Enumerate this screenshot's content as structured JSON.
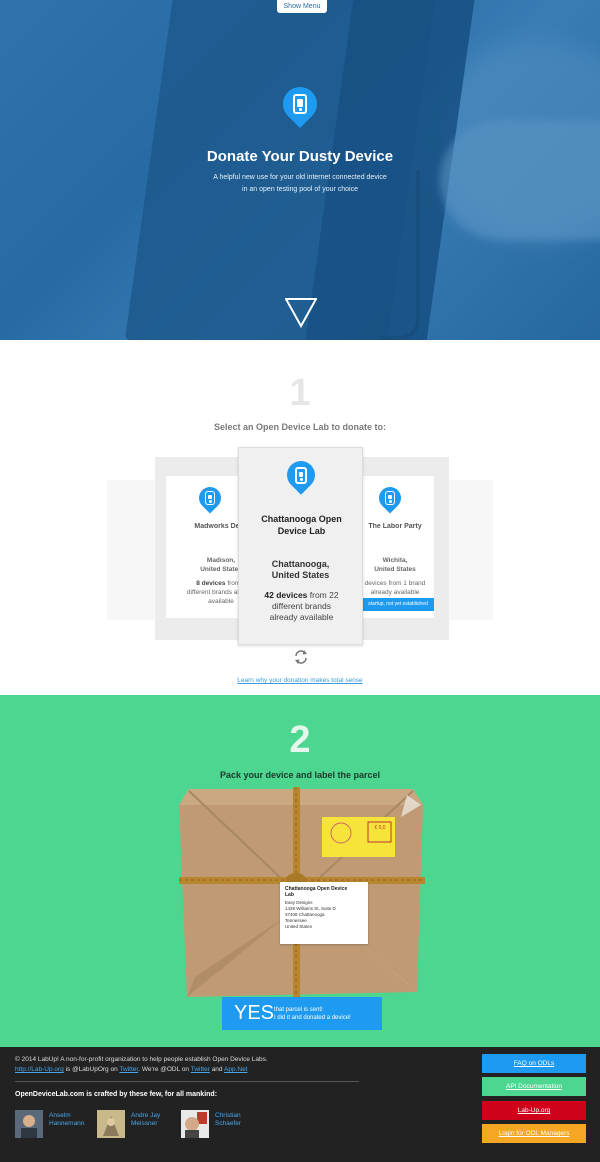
{
  "nav": {
    "show_menu": "Show Menu"
  },
  "hero": {
    "title": "Donate Your Dusty Device",
    "subtitle": "A helpful new use for your old internet connected device in an open testing pool of your choice"
  },
  "step1": {
    "number": "1",
    "label": "Select an Open Device Lab to donate to:",
    "labs": [
      {
        "name": "Madworks Device Lab",
        "city_line1": "Madison,",
        "city_line2": "United States",
        "devices_count": "8 devices",
        "devices_rest_1": " from 5",
        "devices_rest_2": "different brands already",
        "devices_rest_3": "available"
      },
      {
        "name_line1": "Chattanooga Open",
        "name_line2": "Device Lab",
        "city_line1": "Chattanooga,",
        "city_line2": "United States",
        "devices_count": "42 devices",
        "devices_rest_1": " from 22",
        "devices_rest_2": "different brands",
        "devices_rest_3": "already available"
      },
      {
        "name": "The Labor Party",
        "city_line1": "Wichita,",
        "city_line2": "United States",
        "devices_rest_1": "devices from 1 brand",
        "devices_rest_2": "already available",
        "badge": "startup, not yet established"
      }
    ],
    "learn_link": "Learn why your donation makes total sense"
  },
  "step2": {
    "number": "2",
    "label": "Pack your device and label the parcel",
    "stamp": "€ 0,0",
    "address": {
      "name_line1": "Chattanooga Open Device",
      "name_line2": "Lab",
      "line1": "Easy Designs",
      "line2": "1428 Williams St, Suite D",
      "line3": "37408 Chattanooga",
      "line4": "Tennessee",
      "line5": "United States"
    },
    "yes_big": "YES",
    "yes_line1": "that parcel is sent!",
    "yes_line2": "I did it and donated a device!"
  },
  "footer": {
    "copy_1": "© 2014 LabUp! A non-for-profit organization to help people establish Open Device Labs.",
    "labup_link": "http://Lab-Up.org",
    "copy_2": " is @LabUpOrg on ",
    "twitter1": "Twitter",
    "copy_3": ". We're @ODL on ",
    "twitter2": "Twitter",
    "copy_4": " and ",
    "appnet": "App.Net",
    "crafted": "OpenDeviceLab.com is crafted by these few, for all mankind:",
    "people": [
      {
        "first": "Anselm",
        "last": "Hannemann"
      },
      {
        "first": "Andre Jay",
        "last": "Meissner"
      },
      {
        "first": "Christian",
        "last": "Schaefer"
      }
    ],
    "buttons": [
      {
        "label": "FAQ on ODLs",
        "color": "#1e9bf0"
      },
      {
        "label": "API Documentation",
        "color": "#4dd690"
      },
      {
        "label": "Lab-Up.org",
        "color": "#d0021b"
      },
      {
        "label": "Login for ODL Managers",
        "color": "#f5a623"
      }
    ]
  },
  "colors": {
    "brand_blue": "#1e9bf0",
    "brand_green": "#4dd690",
    "footer_bg": "#222222"
  }
}
